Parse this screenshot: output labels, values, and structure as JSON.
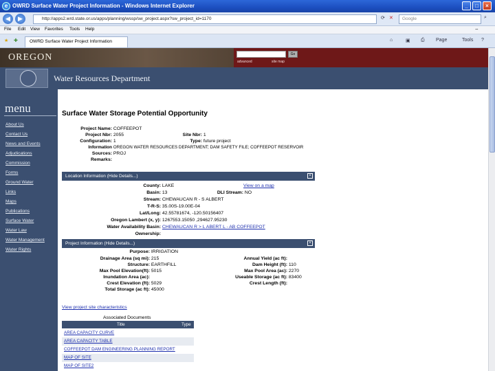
{
  "window": {
    "title": "OWRD Surface Water Project Information - Windows Internet Explorer",
    "url": "http://apps2.wrd.state.or.us/apps/planning/wssp/sw_project.aspx?sw_project_id=1170",
    "search_placeholder": "Google",
    "tab_title": "OWRD Surface Water Project Information",
    "menus": [
      "File",
      "Edit",
      "View",
      "Favorites",
      "Tools",
      "Help"
    ],
    "toolbar": [
      "Page",
      "Tools"
    ]
  },
  "header": {
    "state": "OREGON",
    "department": "Water Resources Department",
    "search_links": [
      "advanced",
      "site map"
    ],
    "go_label": "Go"
  },
  "nav": {
    "title": "menu",
    "items": [
      "About Us",
      "Contact Us",
      "News and Events",
      "Adjudications",
      "Commission",
      "Forms",
      "Ground Water",
      "Links",
      "Maps",
      "Publications",
      "Surface Water",
      "Water Law",
      "Water Management",
      "Water Rights"
    ]
  },
  "page": {
    "heading": "Surface Water Storage Potential Opportunity",
    "project": {
      "project_name_label": "Project Name:",
      "project_name": "COFFEEPOT",
      "project_nbr_label": "Project Nbr:",
      "project_nbr": "2055",
      "site_nbr_label": "Site Nbr:",
      "site_nbr": "1",
      "configuration_label": "Configuration:",
      "configuration": "1",
      "type_label": "Type:",
      "type": "future project",
      "information_label": "Information",
      "information": "OREGON WATER RESOURCES DEPARTMENT; DAM SAFETY FILE; COFFEEPOT RESERVOIR",
      "sources_label": "Sources:",
      "sources": "PROJ",
      "remarks_label": "Remarks:",
      "remarks": ""
    },
    "location": {
      "bar": "Location Information (Hide Details...)",
      "county_label": "County:",
      "county": "LAKE",
      "view_map": "View on a map",
      "basin_label": "Basin:",
      "basin": "13",
      "dli_stream_label": "DLI Stream:",
      "dli_stream": "NO",
      "stream_label": "Stream:",
      "stream": "CHEWAUCAN R - S ALBERT",
      "trs_label": "T-R-S:",
      "trs": "35.00S-19.00E-04",
      "latlong_label": "Lat/Long:",
      "latlong": "42.55781674, -120.50156407",
      "lambert_label": "Oregon Lambert (x, y):",
      "lambert": "1267553.15050 ,294627.95230",
      "wab_label": "Water Availability Basin:",
      "wab": "CHEWAUCAN R > L ABERT L - AB COFFEEPOT",
      "ownership_label": "Ownership:",
      "ownership": ""
    },
    "projinfo": {
      "bar": "Project Information (Hide Details...)",
      "purpose_label": "Purpose:",
      "purpose": "IRRIGATION",
      "drainage_label": "Drainage Area (sq mi):",
      "drainage": "215",
      "annual_yield_label": "Annual Yield (ac ft):",
      "annual_yield": "",
      "structure_label": "Structure:",
      "structure": "EARTHFILL",
      "dam_height_label": "Dam Height (ft):",
      "dam_height": "110",
      "max_pool_elev_label": "Max Pool Elevation(ft):",
      "max_pool_elev": "5015",
      "max_pool_area_label": "Max Pool Area (ac):",
      "max_pool_area": "2270",
      "inundation_label": "Inundation Area (ac):",
      "inundation": "",
      "usable_storage_label": "Useable Storage (ac ft):",
      "usable_storage": "83400",
      "crest_elev_label": "Crest Elevation (ft):",
      "crest_elev": "5029",
      "crest_length_label": "Crest Length (ft):",
      "crest_length": "",
      "total_storage_label": "Total Storage (ac ft):",
      "total_storage": "45000"
    },
    "view_chars": "View project site characteristics",
    "docs": {
      "caption": "Associated Documents",
      "col_title": "Title",
      "col_type": "Type",
      "rows": [
        "AREA CAPACITY CURVE",
        "AREA CAPACITY TABLE",
        "COFFEEPOT DAM ENGINEERING PLANNING REPORT",
        "MAP OF SITE",
        "MAP OF SITE2"
      ]
    }
  }
}
